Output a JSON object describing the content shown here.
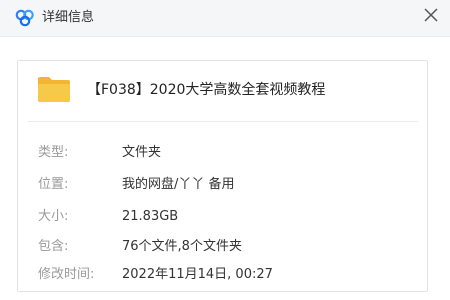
{
  "window": {
    "title": "详细信息",
    "icon": "cloud-logo-icon",
    "close_icon": "close-icon"
  },
  "item": {
    "icon": "folder-icon",
    "name": "【F038】2020大学高数全套视频教程"
  },
  "properties": [
    {
      "label": "类型:",
      "value": "文件夹"
    },
    {
      "label": "位置:",
      "value": "我的网盘/丫丫 备用"
    },
    {
      "label": "大小:",
      "value": "21.83GB"
    },
    {
      "label": "包含:",
      "value": "76个文件,8个文件夹"
    },
    {
      "label": "修改时间:",
      "value": "2022年11月14日, 00:27"
    }
  ],
  "colors": {
    "brand_blue": "#2f7ff5",
    "folder_yellow": "#f5c242",
    "label_gray": "#9a9a9a"
  }
}
